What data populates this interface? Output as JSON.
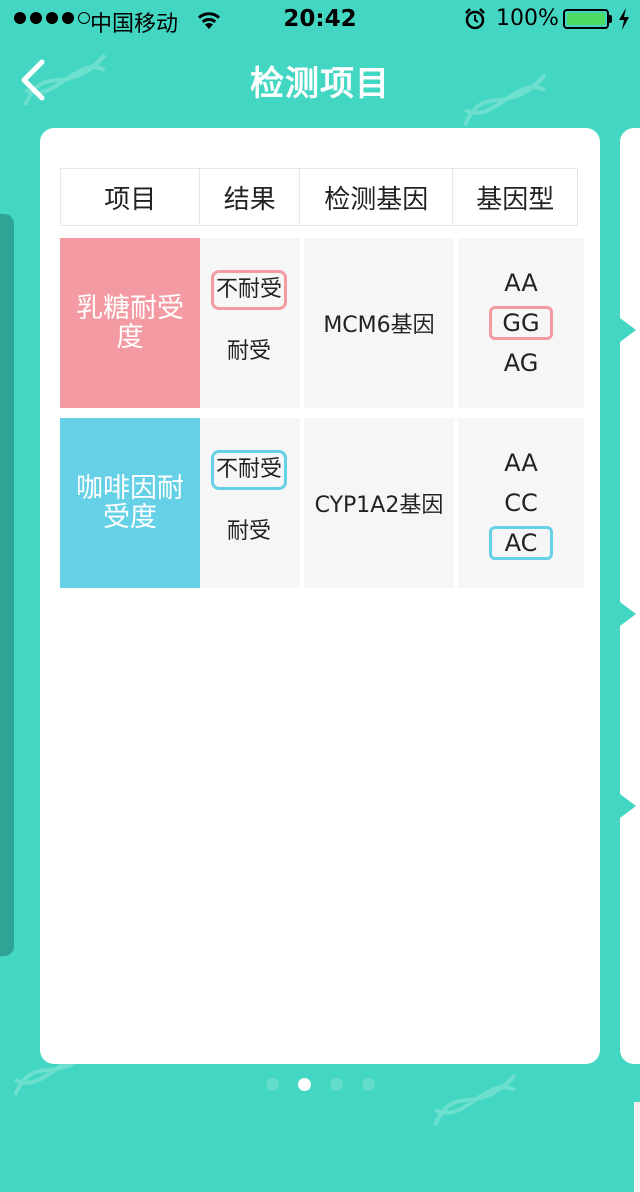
{
  "status_bar": {
    "carrier": "中国移动",
    "time": "20:42",
    "battery": "100%",
    "signal_icon": "signal-dots-icon",
    "wifi_icon": "wifi-icon",
    "alarm_icon": "alarm-clock-icon",
    "battery_icon": "battery-icon",
    "charging_icon": "charging-bolt-icon",
    "battery_color": "#4cd964"
  },
  "nav": {
    "title": "检测项目",
    "back_icon": "back-chevron-icon"
  },
  "theme": {
    "background": "#43d6c2",
    "card": "#ffffff",
    "cell_bg": "#f6f6f6"
  },
  "table": {
    "headers": [
      "项目",
      "结果",
      "检测基因",
      "基因型"
    ],
    "rows": [
      {
        "name": "乳糖耐受度",
        "color": "#f49aa2",
        "results": [
          "不耐受",
          "耐受"
        ],
        "selected_result": "不耐受",
        "gene": "MCM6基因",
        "genotypes": [
          "AA",
          "GG",
          "AG"
        ],
        "selected_genotype": "GG"
      },
      {
        "name": "咖啡因耐受度",
        "color": "#66d0e6",
        "results": [
          "不耐受",
          "耐受"
        ],
        "selected_result": "不耐受",
        "gene": "CYP1A2基因",
        "genotypes": [
          "AA",
          "CC",
          "AC"
        ],
        "selected_genotype": "AC"
      }
    ]
  },
  "pager": {
    "count": 4,
    "active_index": 1
  }
}
